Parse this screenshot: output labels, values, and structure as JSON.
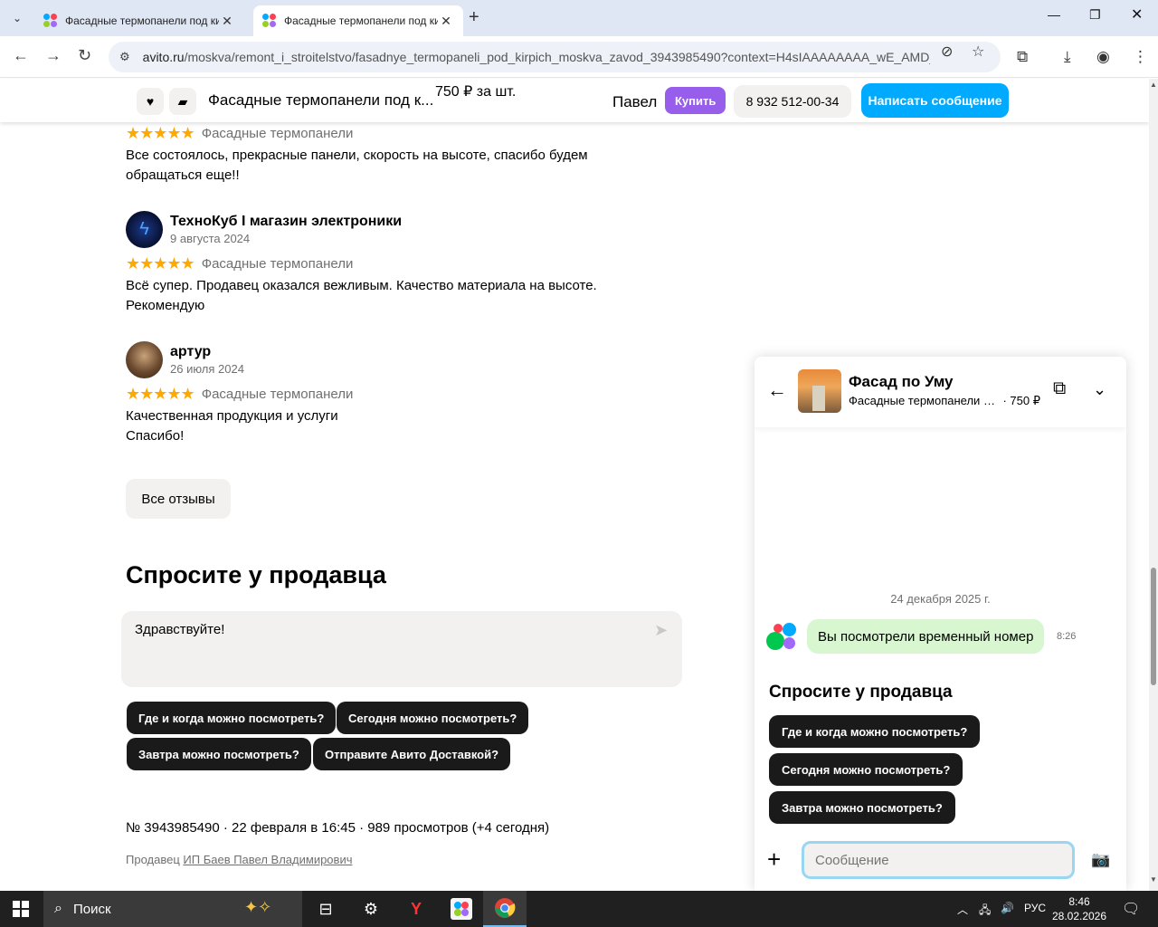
{
  "browser": {
    "tabs": [
      {
        "title": "Фасадные термопанели под кирпич",
        "active": false
      },
      {
        "title": "Фасадные термопанели под кирпич",
        "active": true
      }
    ],
    "url_main": "avito.ru",
    "url_rest": "/moskva/remont_i_stroitelstvo/fasadnye_termopaneli_pod_kirpich_moskva_zavod_3943985490?context=H4sIAAAAAAAA_wE_AMD_..."
  },
  "sticky": {
    "title": "Фасадные термопанели под к...",
    "price": "750 ₽ за шт.",
    "seller": "Павел",
    "buy": "Купить",
    "phone": "8 932 512-00-34",
    "write": "Написать сообщение"
  },
  "reviews": [
    {
      "stars": "★★★★★",
      "category": "Фасадные термопанели",
      "text": "Все состоялось, прекрасные панели, скорость на высоте, спасибо будем обращаться еще!!"
    },
    {
      "name": "ТехноКуб I магазин электроники",
      "date": "9 августа 2024",
      "stars": "★★★★★",
      "category": "Фасадные термопанели",
      "text_1": "Всё супер. Продавец оказался вежливым. Качество материала на высоте.",
      "text_2": "Рекомендую"
    },
    {
      "name": "артур",
      "date": "26 июля 2024",
      "stars": "★★★★★",
      "category": "Фасадные термопанели",
      "text_1": "Качественная продукция и услуги",
      "text_2": "Спасибо!"
    }
  ],
  "all_reviews": "Все отзывы",
  "ask": {
    "heading": "Спросите у продавца",
    "input_value": "Здравствуйте!",
    "chips": [
      "Где и когда можно посмотреть?",
      "Сегодня можно посмотреть?",
      "Завтра можно посмотреть?",
      "Отправите Авито Доставкой?"
    ]
  },
  "ad_info": "№ 3943985490 · 22 февраля в 16:45 · 989 просмотров (+4 сегодня)",
  "seller_prefix": "Продавец",
  "seller_link": "ИП Баев Павел Владимирович",
  "chat": {
    "name": "Фасад по Уму",
    "item": "Фасадные термопанели под кирпич",
    "price": "· 750 ₽",
    "date": "24 декабря 2025 г.",
    "message": "Вы посмотрели временный номер",
    "time": "8:26",
    "ask_heading": "Спросите у продавца",
    "chips": [
      "Где и когда можно посмотреть?",
      "Сегодня можно посмотреть?",
      "Завтра можно посмотреть?"
    ],
    "input_placeholder": "Сообщение"
  },
  "taskbar": {
    "search": "Поиск",
    "lang": "РУС",
    "time": "8:46",
    "date": "28.02.2026"
  },
  "colors": {
    "avito_blue": "#00aaff",
    "buy_purple": "#965eeb",
    "star": "#ffa800",
    "bubble_green": "#d8f7d0"
  }
}
